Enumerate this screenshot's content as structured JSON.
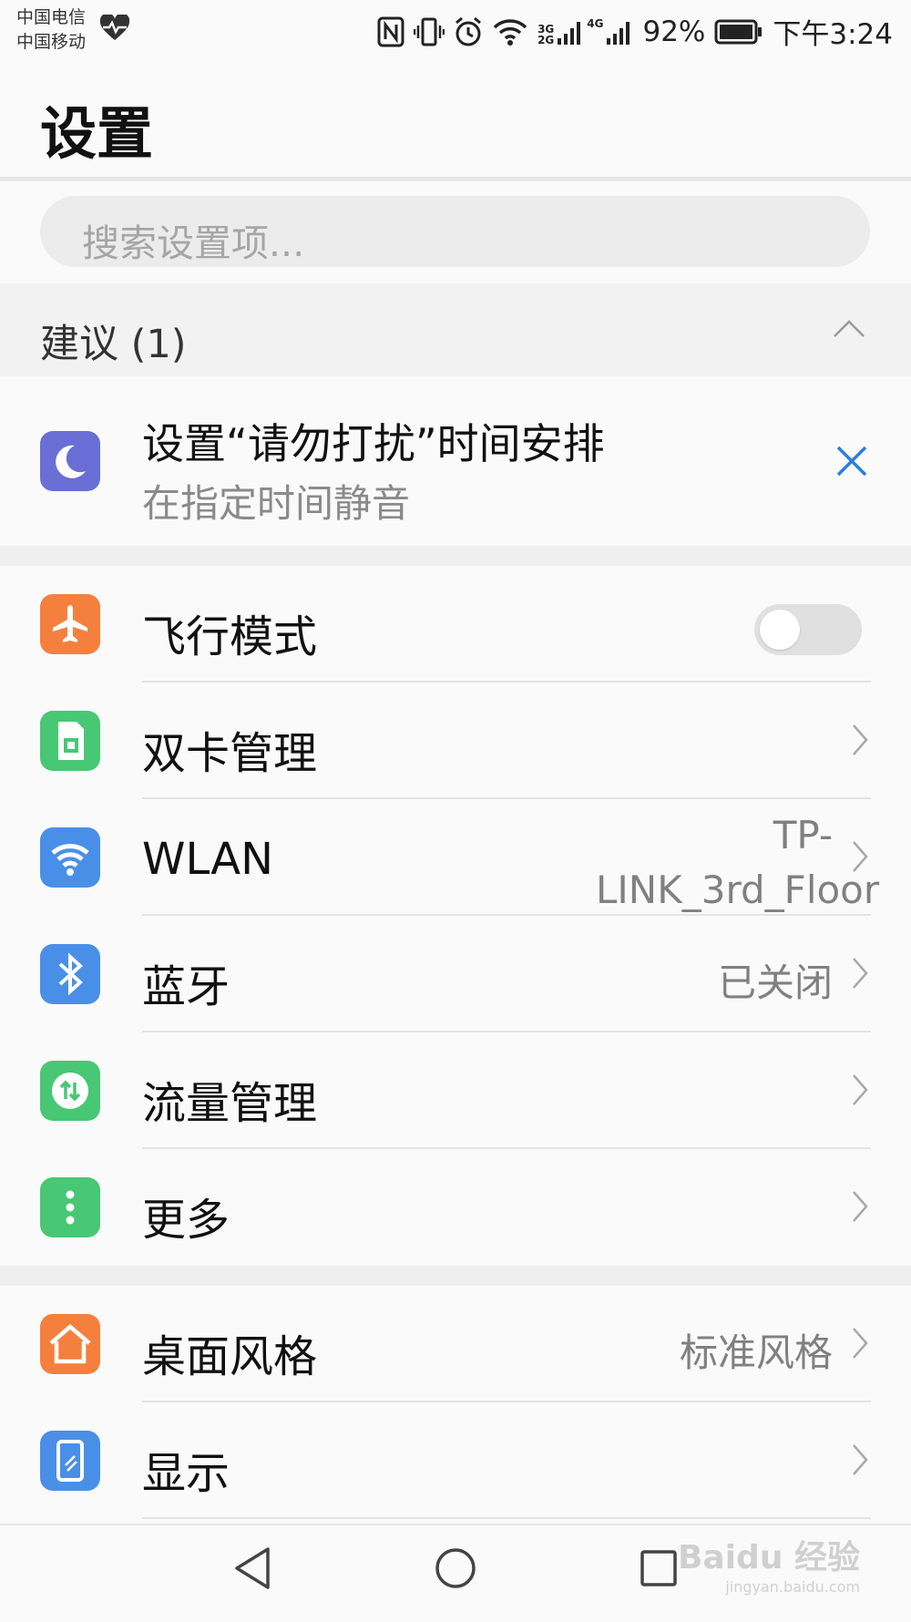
{
  "status_bar": {
    "carrier_1": "中国电信",
    "carrier_2": "中国移动",
    "signal_3g": "3G",
    "signal_2g": "2G",
    "signal_4g": "4G",
    "battery": "92%",
    "time": "下午3:24",
    "icons": [
      "heart-rate-icon",
      "nfc-icon",
      "vibrate-icon",
      "alarm-icon",
      "wifi-icon",
      "signal-icon",
      "battery-icon"
    ]
  },
  "header": {
    "title": "设置"
  },
  "search": {
    "placeholder": "搜索设置项..."
  },
  "suggestions": {
    "header": "建议 (1)",
    "item": {
      "title": "设置“请勿打扰”时间安排",
      "subtitle": "在指定时间静音",
      "icon": "moon-icon",
      "icon_color": "#6a6fd6"
    }
  },
  "group1": [
    {
      "label": "飞行模式",
      "icon": "airplane-icon",
      "color": "#f5803e",
      "control": "toggle",
      "toggle_state": "off"
    },
    {
      "label": "双卡管理",
      "icon": "sim-card-icon",
      "color": "#48c774"
    },
    {
      "label": "WLAN",
      "value": "TP-LINK_3rd_Floor",
      "icon": "wifi-icon",
      "color": "#4a8fe7"
    },
    {
      "label": "蓝牙",
      "value": "已关闭",
      "icon": "bluetooth-icon",
      "color": "#4a8fe7"
    },
    {
      "label": "流量管理",
      "icon": "data-usage-icon",
      "color": "#48c774"
    },
    {
      "label": "更多",
      "icon": "more-icon",
      "color": "#48c774"
    }
  ],
  "group2": [
    {
      "label": "桌面风格",
      "value": "标准风格",
      "icon": "home-icon",
      "color": "#f5803e"
    },
    {
      "label": "显示",
      "icon": "display-icon",
      "color": "#4a8fe7"
    }
  ],
  "nav": {
    "icons": [
      "back-icon",
      "home-circle-icon",
      "recents-icon"
    ]
  },
  "watermark": {
    "brand": "Baidu 经验",
    "url": "jingyan.baidu.com"
  },
  "colors": {
    "accent": "#2a7de1"
  }
}
